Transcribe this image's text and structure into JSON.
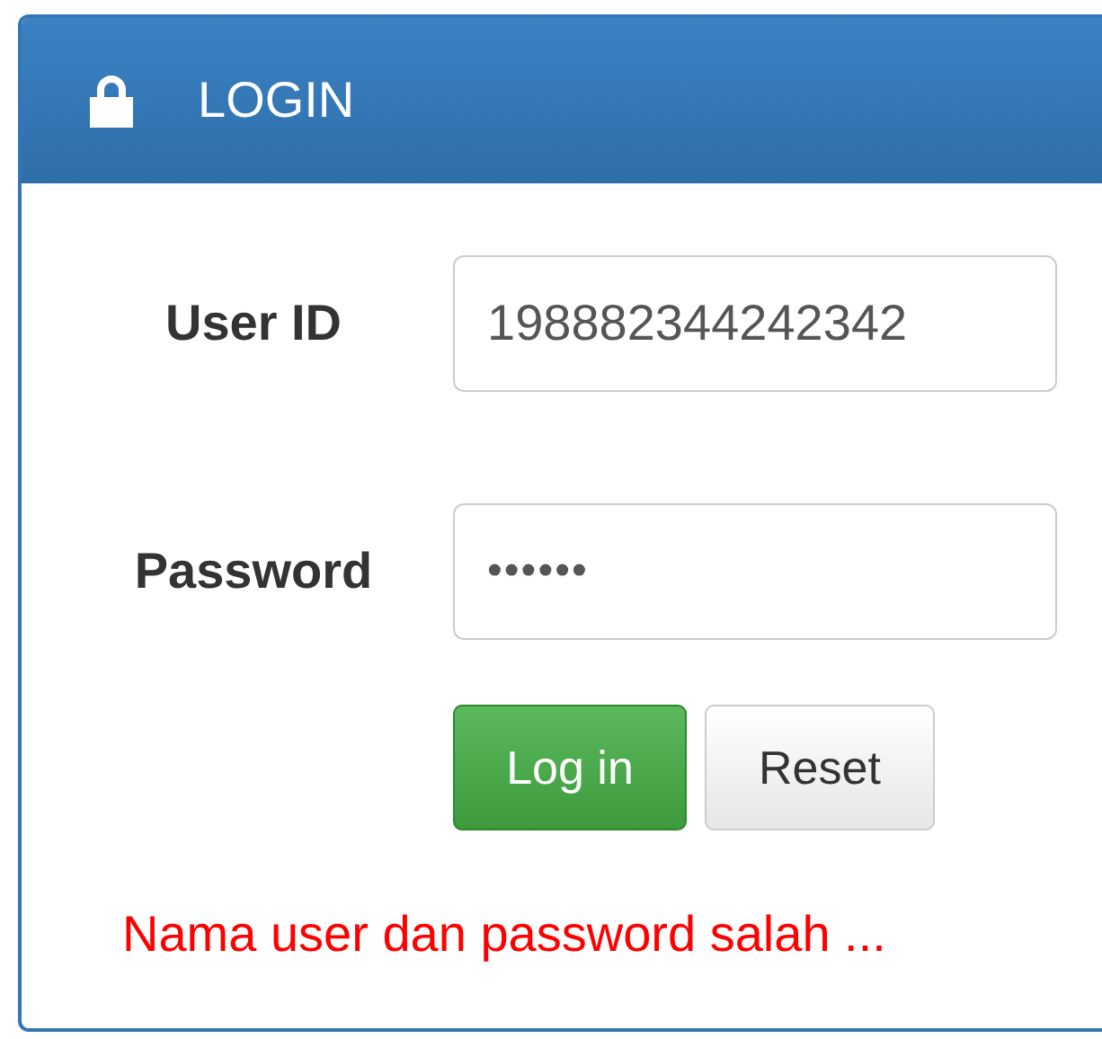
{
  "panel": {
    "title": "LOGIN"
  },
  "fields": [
    {
      "label": "User ID",
      "value": "198882344242342",
      "kind": "text"
    },
    {
      "label": "Password",
      "value": "••••••",
      "kind": "password"
    }
  ],
  "buttons": [
    {
      "label": "Log in",
      "kind": "primary"
    },
    {
      "label": "Reset",
      "kind": "default"
    }
  ],
  "error": "Nama user dan password salah ..."
}
